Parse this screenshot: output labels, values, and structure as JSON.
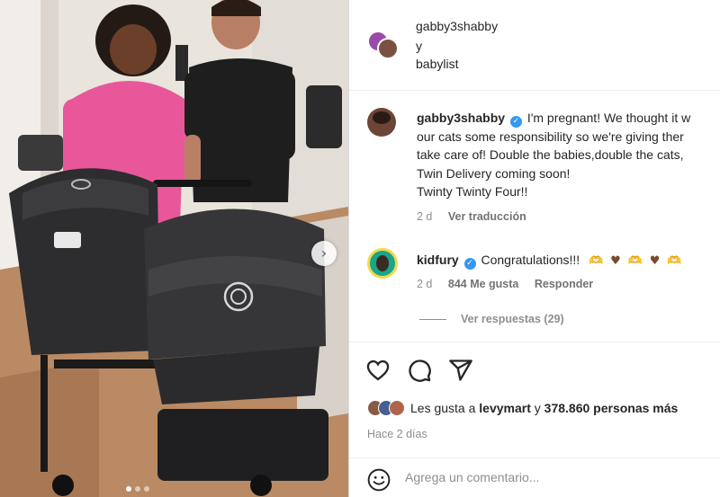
{
  "header": {
    "author1": "gabby3shabby",
    "connector": "y",
    "author2": "babylist"
  },
  "caption": {
    "username": "gabby3shabby",
    "line1": "I'm pregnant! We thought it w",
    "line2": "our cats some responsibility so we're giving ther",
    "line3": "take care of! Double the babies,double the cats,",
    "line4": "Twin Delivery coming soon!",
    "line5": "Twinty Twinty Four!!",
    "time": "2 d",
    "translate": "Ver traducción"
  },
  "reply": {
    "username": "kidfury",
    "text": "Congratulations!!!",
    "time": "2 d",
    "likes": "844 Me gusta",
    "reply_label": "Responder",
    "view_replies": "Ver respuestas (29)"
  },
  "likes": {
    "prefix": "Les gusta a",
    "user": "levymart",
    "middle": "y",
    "count": "378.860 personas más"
  },
  "posted": "Hace 2 días",
  "comment_placeholder": "Agrega un comentario...",
  "icons": {
    "heart": "heart-icon",
    "comment": "comment-icon",
    "share": "share-icon",
    "emoji": "emoji-icon",
    "next": "chevron-right-icon",
    "verified": "verified-badge-icon"
  },
  "colors": {
    "verified": "#3897f0",
    "muted_text": "#8e8e8e",
    "text": "#262626"
  }
}
